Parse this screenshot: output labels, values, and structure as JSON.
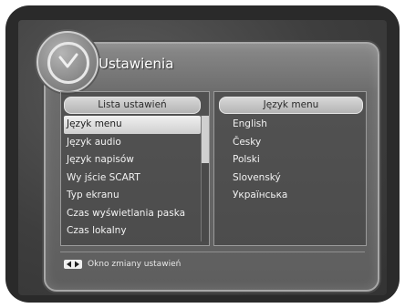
{
  "header": {
    "title": "Ustawienia"
  },
  "left_panel": {
    "header": "Lista ustawień",
    "items": [
      {
        "label": "Język menu"
      },
      {
        "label": "Język audio"
      },
      {
        "label": "Język napisów"
      },
      {
        "label": "Wy jście SCART"
      },
      {
        "label": "Typ ekranu"
      },
      {
        "label": "Czas wyświetlania paska"
      },
      {
        "label": "Czas lokalny"
      }
    ],
    "selected_index": 0,
    "scroll_fraction": 0.38
  },
  "right_panel": {
    "header": "Język menu",
    "options": [
      {
        "label": "English"
      },
      {
        "label": "Česky"
      },
      {
        "label": "Polski"
      },
      {
        "label": "Slovenský"
      },
      {
        "label": "Українська"
      }
    ],
    "checked_index": 2
  },
  "footer": {
    "hint_icon": "left-right-arrows-icon",
    "hint_text": "Okno zmiany ustawień"
  },
  "colors": {
    "selection": "#e4e4e4",
    "menu_frame": "#6c6c6c",
    "text": "#f2f2f2"
  }
}
